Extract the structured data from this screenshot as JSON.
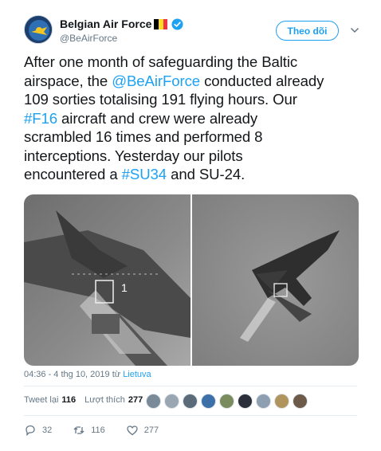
{
  "account": {
    "display_name": "Belgian Air Force",
    "handle": "@BeAirForce",
    "verified": true,
    "flag_colors": [
      "#000000",
      "#fdda24",
      "#ef3340"
    ]
  },
  "follow_button": {
    "label": "Theo dõi"
  },
  "tweet": {
    "lines": [
      [
        {
          "text": "After one month of safeguarding the Baltic",
          "link": false
        }
      ],
      [
        {
          "text": "airspace, the ",
          "link": false
        },
        {
          "text": "@BeAirForce",
          "link": true
        },
        {
          "text": " conducted already",
          "link": false
        }
      ],
      [
        {
          "text": "109 sorties totalising 191 flying hours. Our",
          "link": false
        }
      ],
      [
        {
          "text": "#F16",
          "link": true
        },
        {
          "text": " aircraft and crew were already",
          "link": false
        }
      ],
      [
        {
          "text": "scrambled 16 times and performed 8",
          "link": false
        }
      ],
      [
        {
          "text": "interceptions. Yesterday our pilots",
          "link": false
        }
      ],
      [
        {
          "text": "encountered a ",
          "link": false
        },
        {
          "text": "#SU34",
          "link": true
        },
        {
          "text": " and SU-24.",
          "link": false
        }
      ]
    ],
    "media": [
      {
        "icon": "fighter-jet-photo-1"
      },
      {
        "icon": "fighter-jet-photo-2"
      }
    ],
    "timestamp": "04:36 - 4 thg 10, 2019 từ ",
    "location": "Lietuva"
  },
  "stats": {
    "retweets_label": "Tweet lại",
    "retweets": "116",
    "likes_label": "Lượt thích",
    "likes": "277"
  },
  "likers": [
    "#7b8a98",
    "#9aa7b3",
    "#5c6b79",
    "#3d6fa8",
    "#7a8c5e",
    "#2b2f3a",
    "#8d9fb0",
    "#b0945e",
    "#6e5a48"
  ],
  "actions": {
    "replies": "32",
    "retweets": "116",
    "likes": "277"
  },
  "colors": {
    "link": "#1da1f2",
    "muted": "#657786",
    "text": "#14171a"
  }
}
